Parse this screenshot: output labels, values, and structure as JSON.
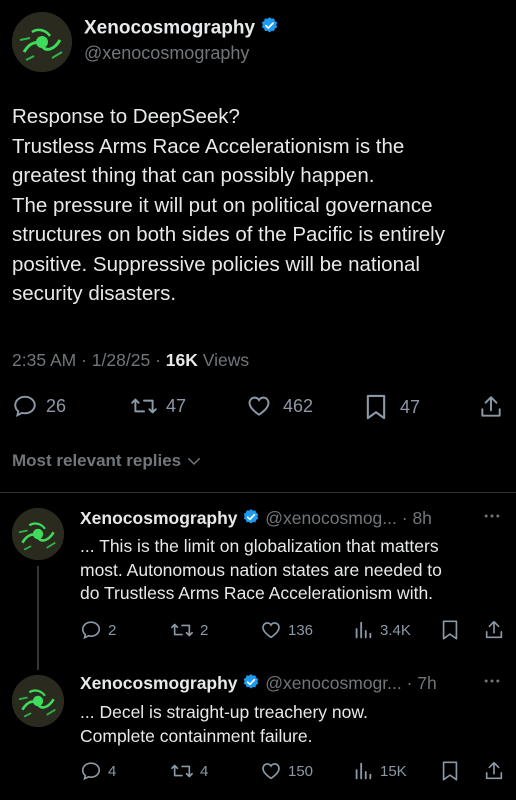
{
  "tweet": {
    "author_name": "Xenocosmography",
    "author_handle": "@xenocosmography",
    "lines": [
      "Response to DeepSeek?",
      "Trustless Arms Race Accelerationism is the",
      "greatest thing that can possibly happen.",
      "The pressure it will put on political governance",
      "structures on both sides of the Pacific is entirely",
      "positive. Suppressive policies will be national",
      "security disasters."
    ],
    "time": "2:35 AM",
    "date": "1/28/25",
    "views_count": "16K",
    "views_label": "Views",
    "stats": {
      "replies": "26",
      "reposts": "47",
      "likes": "462",
      "bookmarks": "47"
    }
  },
  "replies_header": "Most relevant replies",
  "replies": [
    {
      "author_name": "Xenocosmography",
      "author_handle": "@xenocosmog...",
      "age": "8h",
      "lines": [
        "... This is the limit on globalization that matters",
        "most. Autonomous nation states are needed to",
        "do Trustless Arms Race Accelerationism with."
      ],
      "stats": {
        "replies": "2",
        "reposts": "2",
        "likes": "136",
        "views": "3.4K"
      }
    },
    {
      "author_name": "Xenocosmography",
      "author_handle": "@xenocosmogr...",
      "age": "7h",
      "lines": [
        "... Decel is straight-up treachery now.",
        "Complete containment failure."
      ],
      "stats": {
        "replies": "4",
        "reposts": "4",
        "likes": "150",
        "views": "15K"
      }
    }
  ],
  "colors": {
    "background": "#000000",
    "text": "#e7e9ea",
    "secondary": "#71767b",
    "verified": "#1d9bf0",
    "divider": "#2f3336"
  }
}
